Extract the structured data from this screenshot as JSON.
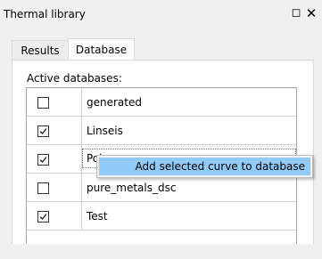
{
  "window": {
    "title": "Thermal library",
    "float_icon": "restore-icon",
    "close_icon": "close-icon"
  },
  "tabs": [
    {
      "label": "Results",
      "selected": false
    },
    {
      "label": "Database",
      "selected": true
    }
  ],
  "database_panel": {
    "active_label": "Active databases:",
    "rows": [
      {
        "name": "generated",
        "checked": false
      },
      {
        "name": "Linseis",
        "checked": true
      },
      {
        "name": "Polyme",
        "checked": true
      },
      {
        "name": "pure_metals_dsc",
        "checked": false
      },
      {
        "name": "Test",
        "checked": true
      }
    ]
  },
  "context_menu": {
    "items": [
      {
        "label": "Add selected curve to database",
        "highlighted": true
      }
    ]
  },
  "colors": {
    "menu_highlight": "#91c9f7",
    "window_bg": "#f0f0f0",
    "panel_bg": "#ffffff"
  }
}
